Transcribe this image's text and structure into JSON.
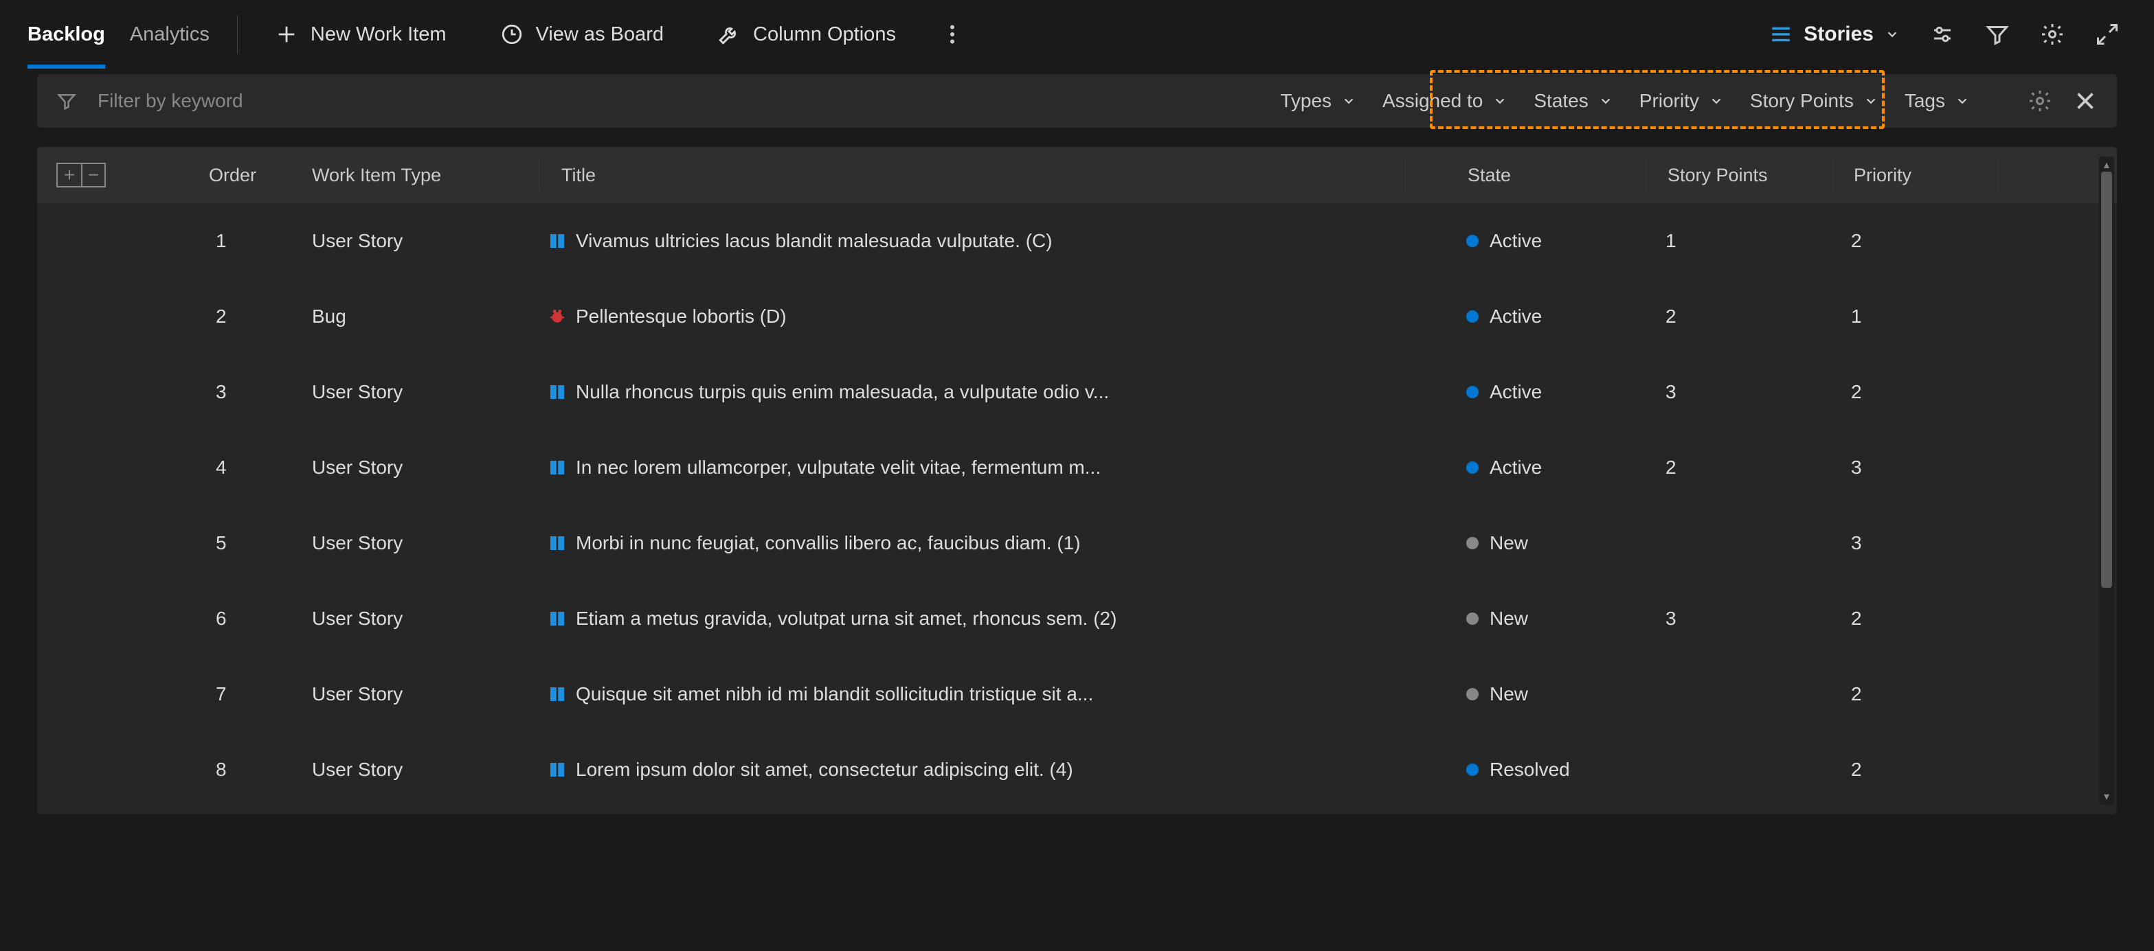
{
  "tabs": {
    "backlog": "Backlog",
    "analytics": "Analytics"
  },
  "toolbar": {
    "new_item": "New Work Item",
    "view_board": "View as Board",
    "column_options": "Column Options",
    "view_picker": "Stories"
  },
  "filter": {
    "placeholder": "Filter by keyword",
    "types": "Types",
    "assigned_to": "Assigned to",
    "states": "States",
    "priority": "Priority",
    "story_points": "Story Points",
    "tags": "Tags"
  },
  "columns": {
    "order": "Order",
    "type": "Work Item Type",
    "title": "Title",
    "state": "State",
    "sp": "Story Points",
    "priority": "Priority"
  },
  "rows": [
    {
      "order": "1",
      "type": "User Story",
      "icon": "story",
      "expandable": true,
      "title": "Vivamus ultricies lacus blandit malesuada vulputate. (C)",
      "state": "Active",
      "state_class": "active",
      "sp": "1",
      "pri": "2"
    },
    {
      "order": "2",
      "type": "Bug",
      "icon": "bug",
      "expandable": true,
      "title": "Pellentesque lobortis (D)",
      "state": "Active",
      "state_class": "active",
      "sp": "2",
      "pri": "1"
    },
    {
      "order": "3",
      "type": "User Story",
      "icon": "story",
      "expandable": true,
      "title": "Nulla rhoncus turpis quis enim malesuada, a vulputate odio v...",
      "state": "Active",
      "state_class": "active",
      "sp": "3",
      "pri": "2"
    },
    {
      "order": "4",
      "type": "User Story",
      "icon": "story",
      "expandable": true,
      "title": "In nec lorem ullamcorper, vulputate velit vitae, fermentum m...",
      "state": "Active",
      "state_class": "active",
      "sp": "2",
      "pri": "3"
    },
    {
      "order": "5",
      "type": "User Story",
      "icon": "story",
      "expandable": false,
      "title": "Morbi in nunc feugiat, convallis libero ac, faucibus diam. (1)",
      "state": "New",
      "state_class": "new",
      "sp": "",
      "pri": "3"
    },
    {
      "order": "6",
      "type": "User Story",
      "icon": "story",
      "expandable": false,
      "title": "Etiam a metus gravida, volutpat urna sit amet, rhoncus sem. (2)",
      "state": "New",
      "state_class": "new",
      "sp": "3",
      "pri": "2"
    },
    {
      "order": "7",
      "type": "User Story",
      "icon": "story",
      "expandable": false,
      "title": "Quisque sit amet nibh id mi blandit sollicitudin tristique sit a...",
      "state": "New",
      "state_class": "new",
      "sp": "",
      "pri": "2"
    },
    {
      "order": "8",
      "type": "User Story",
      "icon": "story",
      "expandable": false,
      "title": "Lorem ipsum dolor sit amet, consectetur adipiscing elit. (4)",
      "state": "Resolved",
      "state_class": "resolved",
      "sp": "",
      "pri": "2"
    }
  ],
  "colors": {
    "accent": "#0078d4",
    "highlight": "#ff8c00"
  }
}
